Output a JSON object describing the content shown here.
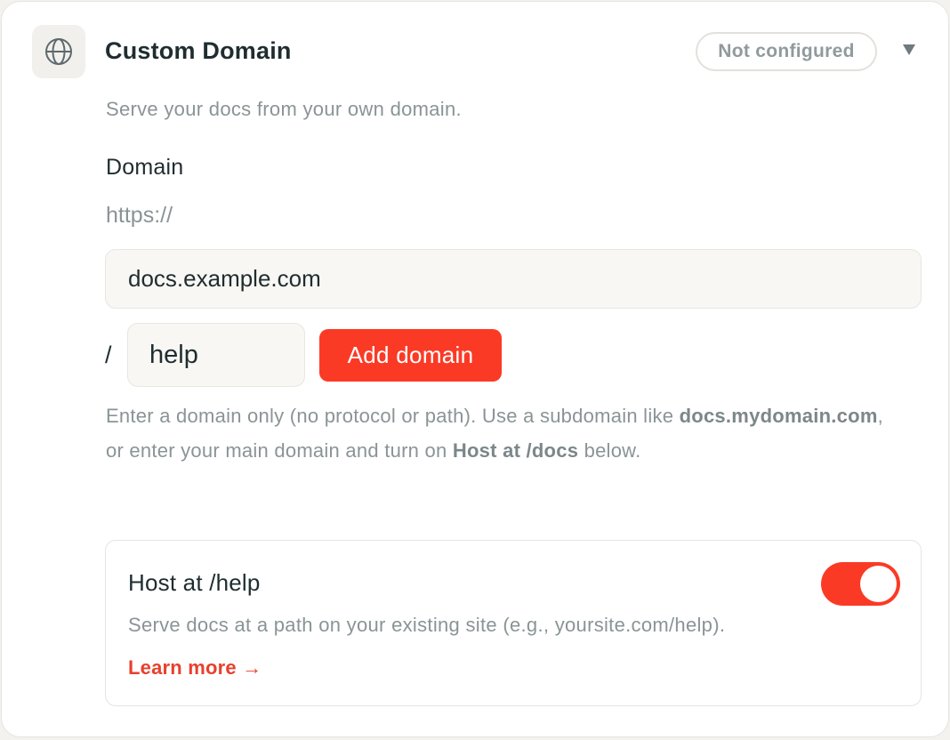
{
  "header": {
    "icon": "globe-icon",
    "title": "Custom Domain",
    "status": "Not configured",
    "chevron_icon": "chevron-down-icon"
  },
  "subtitle": "Serve your docs from your own domain.",
  "domain_field": {
    "label": "Domain",
    "prefix": "https://",
    "value": "docs.example.com"
  },
  "path_field": {
    "separator": "/",
    "value": "help"
  },
  "add_button_label": "Add domain",
  "help_text": {
    "part1": "Enter a domain only (no protocol or path). Use a subdomain like ",
    "bold1": "docs.mydomain.com",
    "part2": ", or enter your main domain and turn on ",
    "bold2": "Host at /docs",
    "part3": " below."
  },
  "host_section": {
    "title": "Host at /help",
    "enabled": true,
    "description": "Serve docs at a path on your existing site (e.g., yoursite.com/help).",
    "learn_more": "Learn more →"
  },
  "colors": {
    "accent": "#fb3a26",
    "link": "#e8402c",
    "muted_text": "#8a9496",
    "primary_text": "#1f2d30"
  }
}
